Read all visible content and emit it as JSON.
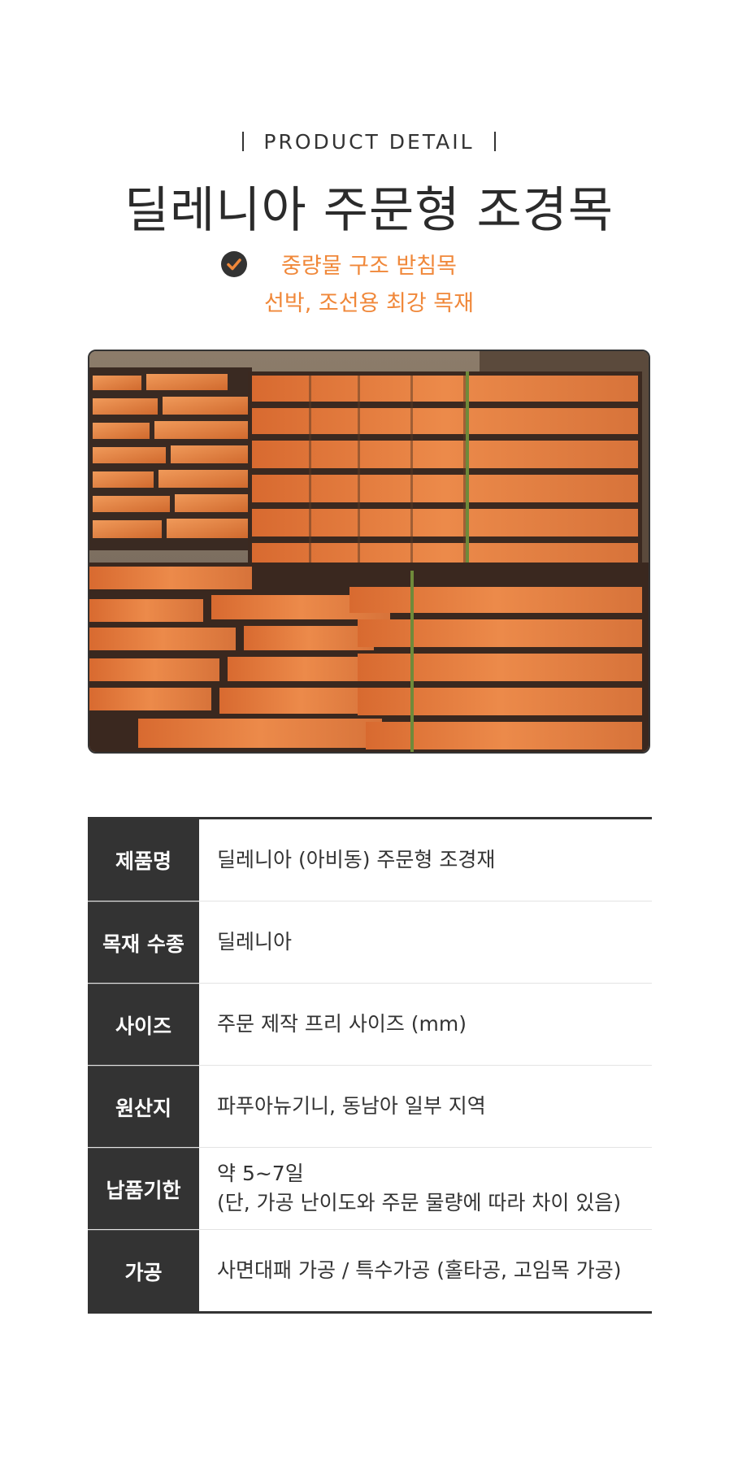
{
  "header": {
    "eyebrow": "PRODUCT DETAIL",
    "title": "딜레니아 주문형 조경목",
    "feature_line1": "중량물 구조 받침목",
    "feature_line2": "선박, 조선용 최강 목재",
    "check_icon": "check-circle-icon"
  },
  "colors": {
    "accent": "#f0883a",
    "dark": "#333333",
    "wood": "#e0793a"
  },
  "specs": {
    "rows": [
      {
        "label": "제품명",
        "value": "딜레니아 (아비동) 주문형 조경재"
      },
      {
        "label": "목재 수종",
        "value": "딜레니아"
      },
      {
        "label": "사이즈",
        "value": "주문 제작 프리 사이즈 (mm)"
      },
      {
        "label": "원산지",
        "value": "파푸아뉴기니, 동남아  일부 지역"
      },
      {
        "label": "납품기한",
        "value": "약 5~7일",
        "value2": "(단, 가공 난이도와 주문 물량에 따라 차이 있음)"
      },
      {
        "label": "가공",
        "value": "사면대패 가공  / 특수가공 (홀타공, 고임목 가공)"
      }
    ]
  }
}
